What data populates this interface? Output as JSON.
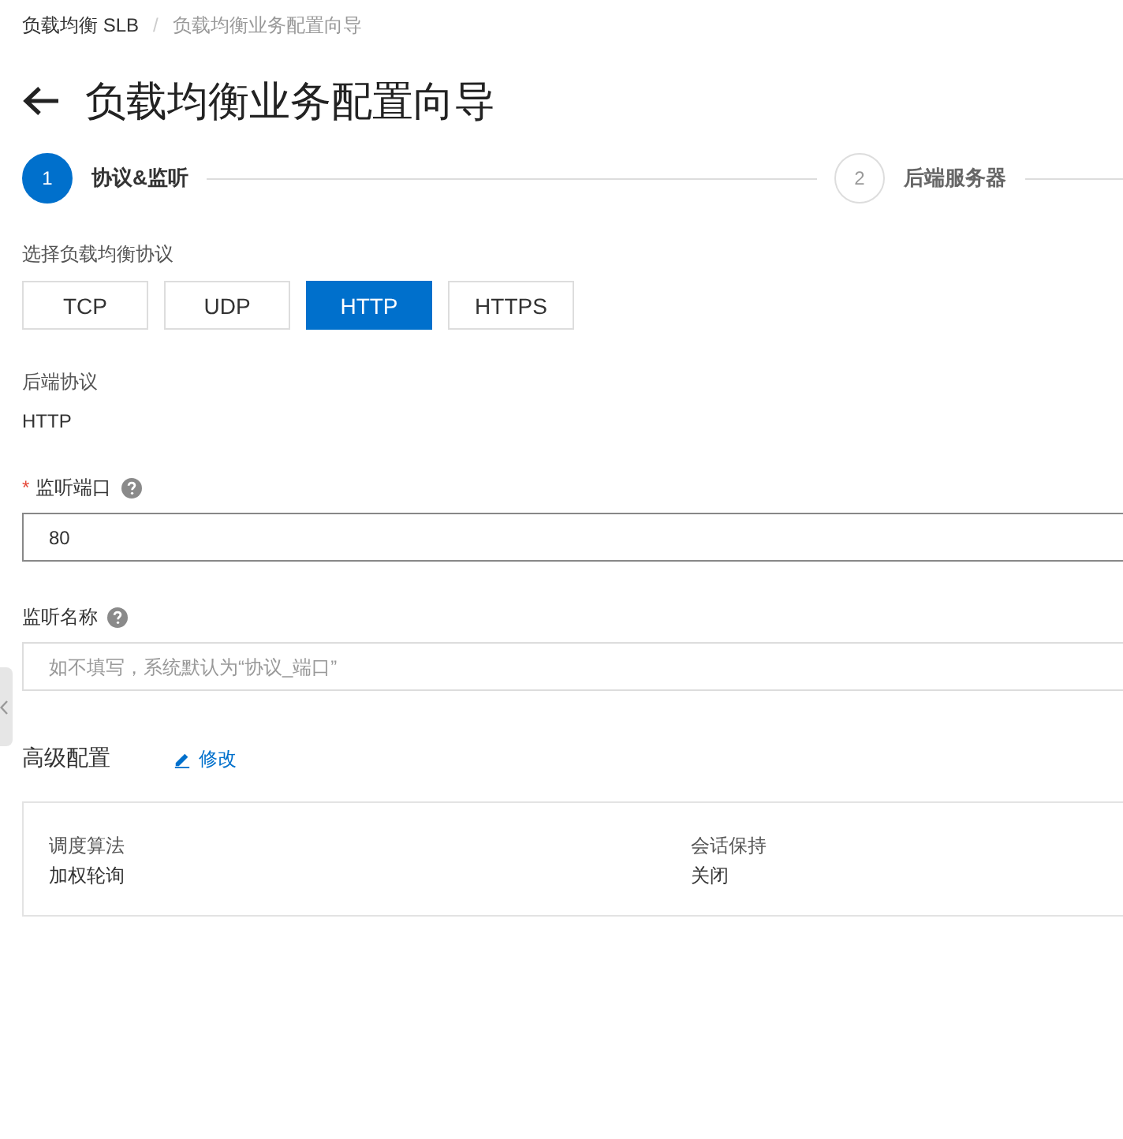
{
  "breadcrumb": {
    "items": [
      "负载均衡 SLB",
      "负载均衡业务配置向导"
    ],
    "separator": "/"
  },
  "title": "负载均衡业务配置向导",
  "steps": [
    {
      "number": "1",
      "label": "协议&监听",
      "selected": true
    },
    {
      "number": "2",
      "label": "后端服务器",
      "selected": false
    }
  ],
  "protocol": {
    "label": "选择负载均衡协议",
    "options": [
      {
        "label": "TCP",
        "selected": false
      },
      {
        "label": "UDP",
        "selected": false
      },
      {
        "label": "HTTP",
        "selected": true
      },
      {
        "label": "HTTPS",
        "selected": false
      }
    ]
  },
  "backend_protocol": {
    "label": "后端协议",
    "value": "HTTP"
  },
  "listen_port": {
    "required_mark": "*",
    "label": "监听端口",
    "value": "80",
    "focused": true
  },
  "listen_name": {
    "label": "监听名称",
    "placeholder": "如不填写，系统默认为“协议_端口”",
    "focused": false
  },
  "advanced": {
    "title": "高级配置",
    "edit_link": "修改",
    "items": [
      {
        "label": "调度算法",
        "value": "加权轮询"
      },
      {
        "label": "会话保持",
        "value": "关闭"
      }
    ]
  }
}
